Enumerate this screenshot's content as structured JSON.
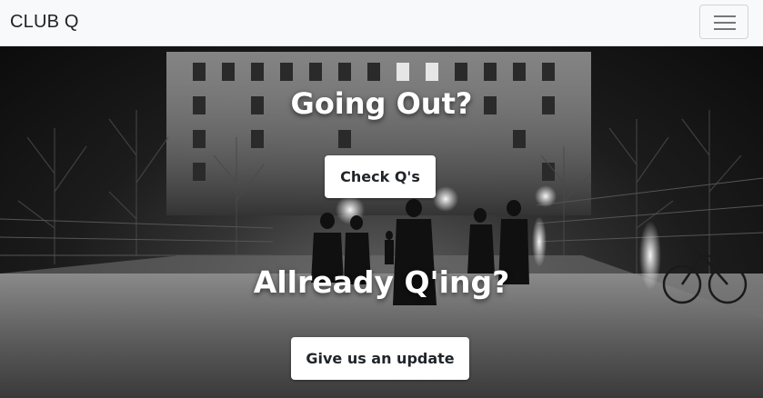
{
  "navbar": {
    "brand": "CLUB Q",
    "toggler_icon": "hamburger-menu-icon"
  },
  "hero": {
    "background": "night-snow-club-entrance-photo",
    "heading_primary": "Going Out?",
    "button_primary": "Check Q's",
    "heading_secondary": "Allready Q'ing?",
    "button_secondary": "Give us an update"
  },
  "colors": {
    "navbar_bg": "#f8f9fa",
    "heading_text": "#ffffff",
    "button_bg": "#ffffff",
    "button_text": "#212529"
  }
}
